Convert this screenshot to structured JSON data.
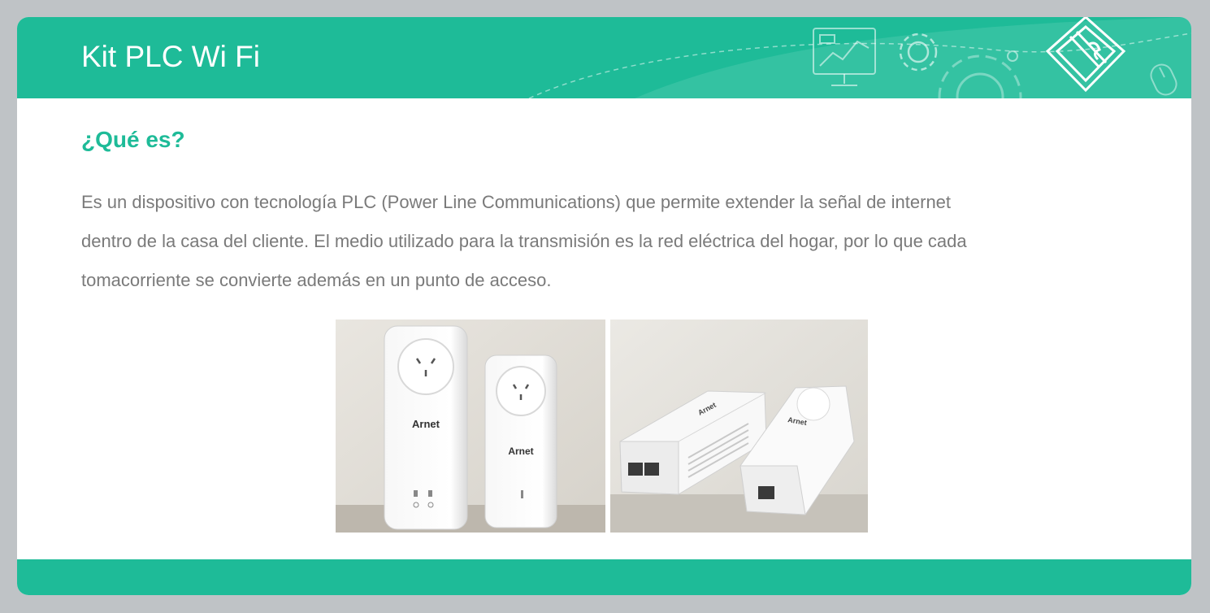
{
  "header": {
    "title": "Kit PLC Wi Fi",
    "decoration_icons": [
      "monitor-chart-icon",
      "gear-icon",
      "gear-large-icon",
      "puzzle-pencil-icon",
      "mouse-icon"
    ]
  },
  "section": {
    "heading": "¿Qué es?",
    "lines": [
      "Es un dispositivo con tecnología PLC (Power Line Communications) que permite extender la señal de internet",
      "dentro de la casa del cliente. El medio utilizado para la transmisión es la red eléctrica del hogar, por lo que cada",
      "tomacorriente se convierte además en un punto de acceso."
    ]
  },
  "photos": {
    "brand_label": "Arnet"
  },
  "colors": {
    "accent": "#1ebb98",
    "background": "#bfc3c6",
    "body_text": "#7a7a7a"
  }
}
